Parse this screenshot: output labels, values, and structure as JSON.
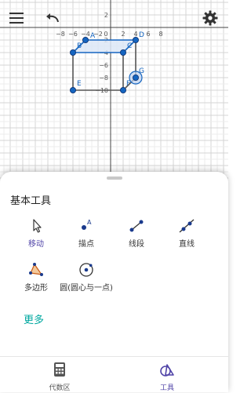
{
  "graph": {
    "x_ticks": [
      "−8",
      "−6",
      "−4",
      "−2",
      "0",
      "2",
      "4",
      "6",
      "8"
    ],
    "y_ticks": [
      "2",
      "−2",
      "−4",
      "−6",
      "−8",
      "−10"
    ],
    "points": [
      {
        "name": "A",
        "x": -4,
        "y": -2
      },
      {
        "name": "B",
        "x": -6,
        "y": -4
      },
      {
        "name": "C",
        "x": 2,
        "y": -4
      },
      {
        "name": "D",
        "x": 4,
        "y": -2
      },
      {
        "name": "E",
        "x": -6,
        "y": -10
      },
      {
        "name": "F",
        "x": 2,
        "y": -10
      },
      {
        "name": "G",
        "x": 4,
        "y": -8
      }
    ],
    "polygon": [
      "A",
      "D",
      "C",
      "B"
    ],
    "segments": [
      [
        "B",
        "E"
      ],
      [
        "E",
        "F"
      ],
      [
        "F",
        "C"
      ],
      [
        "F",
        "G"
      ],
      [
        "G",
        "D"
      ]
    ],
    "selected_point": "G",
    "colors": {
      "blue": "#1565c0",
      "polygon_fill": "#dde8f7",
      "gray": "#555555"
    }
  },
  "toolbar": {
    "menu_icon": "menu-icon",
    "undo_icon": "undo-icon",
    "settings_icon": "gear-icon"
  },
  "panel": {
    "title": "基本工具",
    "tools": [
      {
        "label": "移动",
        "icon": "move-cursor-icon"
      },
      {
        "label": "描点",
        "icon": "point-icon"
      },
      {
        "label": "线段",
        "icon": "segment-icon"
      },
      {
        "label": "直线",
        "icon": "line-icon"
      },
      {
        "label": "多边形",
        "icon": "polygon-icon"
      },
      {
        "label": "圆(圆心与一点)",
        "icon": "circle-icon"
      }
    ],
    "more_label": "更多",
    "active_tool": "移动"
  },
  "bottom_nav": {
    "items": [
      {
        "label": "代数区",
        "icon": "calculator-icon"
      },
      {
        "label": "工具",
        "icon": "tools-icon"
      }
    ],
    "active": "工具"
  }
}
